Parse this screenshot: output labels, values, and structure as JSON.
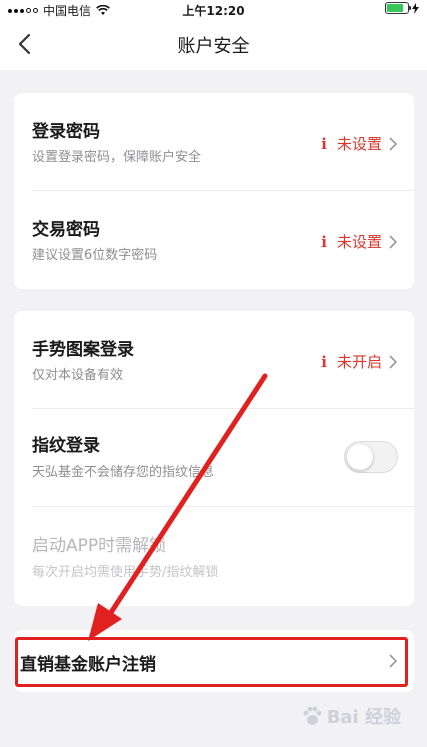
{
  "status_bar": {
    "carrier": "中国电信",
    "time": "上午12:20",
    "battery_level": 0.9
  },
  "nav": {
    "title": "账户安全"
  },
  "password_section": {
    "items": [
      {
        "title": "登录密码",
        "subtitle": "设置登录密码，保障账户安全",
        "status": "未设置"
      },
      {
        "title": "交易密码",
        "subtitle": "建议设置6位数字密码",
        "status": "未设置"
      }
    ]
  },
  "login_section": {
    "gesture": {
      "title": "手势图案登录",
      "subtitle": "仅对本设备有效",
      "status": "未开启"
    },
    "fingerprint": {
      "title": "指纹登录",
      "subtitle": "天弘基金不会储存您的指纹信息",
      "enabled": false
    },
    "unlock_on_start": {
      "title": "启动APP时需解锁",
      "subtitle": "每次开启均需使用手势/指纹解锁"
    }
  },
  "cancel_section": {
    "title": "直销基金账户注销"
  },
  "watermark": {
    "text": "Bai 经验"
  },
  "colors": {
    "accent_red": "#d9362c",
    "annotation_red": "#e12020",
    "background": "#f2f2f4",
    "battery_green": "#34c759"
  }
}
